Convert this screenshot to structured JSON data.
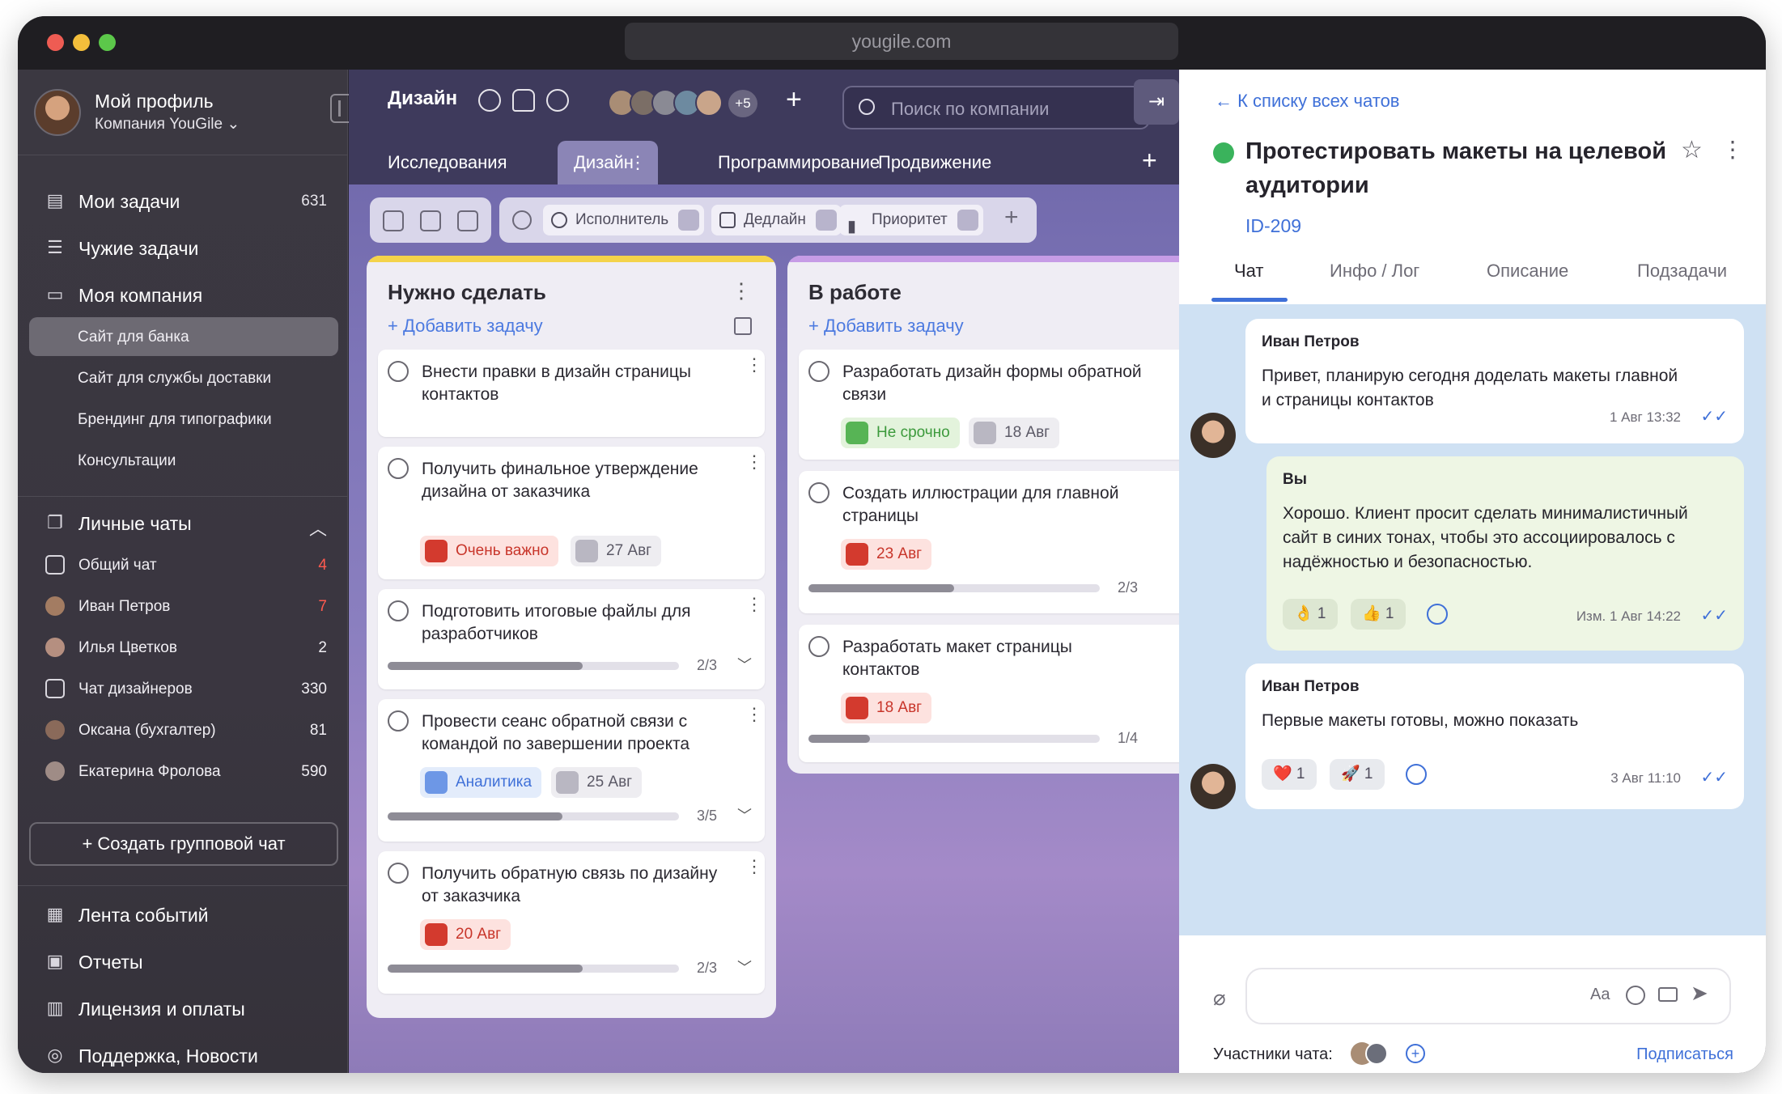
{
  "browser": {
    "url": "yougile.com"
  },
  "sidebar": {
    "profile_name": "Мой профиль",
    "company": "Компания YouGile ⌄",
    "nav": [
      {
        "label": "Мои задачи",
        "count": "631",
        "icon": "tasks-icon"
      },
      {
        "label": "Чужие задачи",
        "count": "",
        "icon": "list-icon"
      },
      {
        "label": "Моя компания",
        "count": "",
        "icon": "briefcase-icon"
      }
    ],
    "projects": [
      "Сайт для банка",
      "Сайт для службы доставки",
      "Брендинг для типографики",
      "Консультации"
    ],
    "chats_header": "Личные чаты",
    "chats": [
      {
        "label": "Общий чат",
        "count": "4"
      },
      {
        "label": "Иван Петров",
        "count": "7"
      },
      {
        "label": "Илья Цветков",
        "count": "2"
      },
      {
        "label": "Чат дизайнеров",
        "count": "330"
      },
      {
        "label": "Оксана (бухгалтер)",
        "count": "81"
      },
      {
        "label": "Екатерина Фролова",
        "count": "590"
      }
    ],
    "create_group": "+ Создать групповой чат",
    "bottom": [
      "Лента событий",
      "Отчеты",
      "Лицензия и оплаты",
      "Поддержка, Новости"
    ]
  },
  "board": {
    "title": "Дизайн",
    "more_members": "+5",
    "search_placeholder": "Поиск по компании",
    "tabs": [
      "Исследования",
      "Дизайн",
      "Программирование",
      "Продвижение"
    ],
    "filters": [
      "Исполнитель",
      "Дедлайн",
      "Приоритет"
    ],
    "add_task": "+ Добавить задачу",
    "columns": [
      {
        "title": "Нужно сделать",
        "cards": [
          {
            "title": "Внести правки в дизайн страницы контактов"
          },
          {
            "title": "Получить финальное утверждение дизайна от заказчика",
            "tag": "Очень важно",
            "date": "27 Авг"
          },
          {
            "title": "Подготовить итоговые файлы для разработчиков",
            "progress": "2/3"
          },
          {
            "title": "Провести сеанс обратной связи с командой по завершении проекта",
            "tag": "Аналитика",
            "date": "25 Авг",
            "progress": "3/5"
          },
          {
            "title": "Получить обратную связь по дизайну от заказчика",
            "date": "20 Авг",
            "progress": "2/3"
          }
        ]
      },
      {
        "title": "В работе",
        "cards": [
          {
            "title": "Разработать дизайн формы обратной связи",
            "tag": "Не срочно",
            "date": "18 Авг"
          },
          {
            "title": "Создать иллюстрации для главной страницы",
            "date": "23 Авг",
            "progress": "2/3"
          },
          {
            "title": "Разработать макет страницы контактов",
            "date": "18 Авг",
            "progress": "1/4"
          }
        ]
      }
    ]
  },
  "panel": {
    "back": "←  К списку всех чатов",
    "task_title": "Протестировать макеты на целевой аудитории",
    "task_id": "ID-209",
    "tabs": [
      "Чат",
      "Инфо / Лог",
      "Описание",
      "Подзадачи"
    ],
    "messages": [
      {
        "author": "Иван Петров",
        "text_line1": "Привет, планирую сегодня доделать макеты главной",
        "text_line2": "и страницы контактов",
        "time": "1 Авг 13:32"
      },
      {
        "author": "Вы",
        "text_line1": "Хорошо. Клиент просит сделать минималистичный",
        "text_line2": "сайт в синих тонах, чтобы это ассоциировалось с",
        "text_line3": "надёжностью и безопасностью.",
        "r1": "👌 1",
        "r2": "👍 1",
        "time": "Изм. 1 Авг 14:22"
      },
      {
        "author": "Иван Петров",
        "text_line1": "Первые макеты готовы, можно показать",
        "r1": "❤️ 1",
        "r2": "🚀 1",
        "time": "3 Авг 11:10"
      }
    ],
    "participants": "Участники чата:",
    "subscribe": "Подписаться"
  }
}
